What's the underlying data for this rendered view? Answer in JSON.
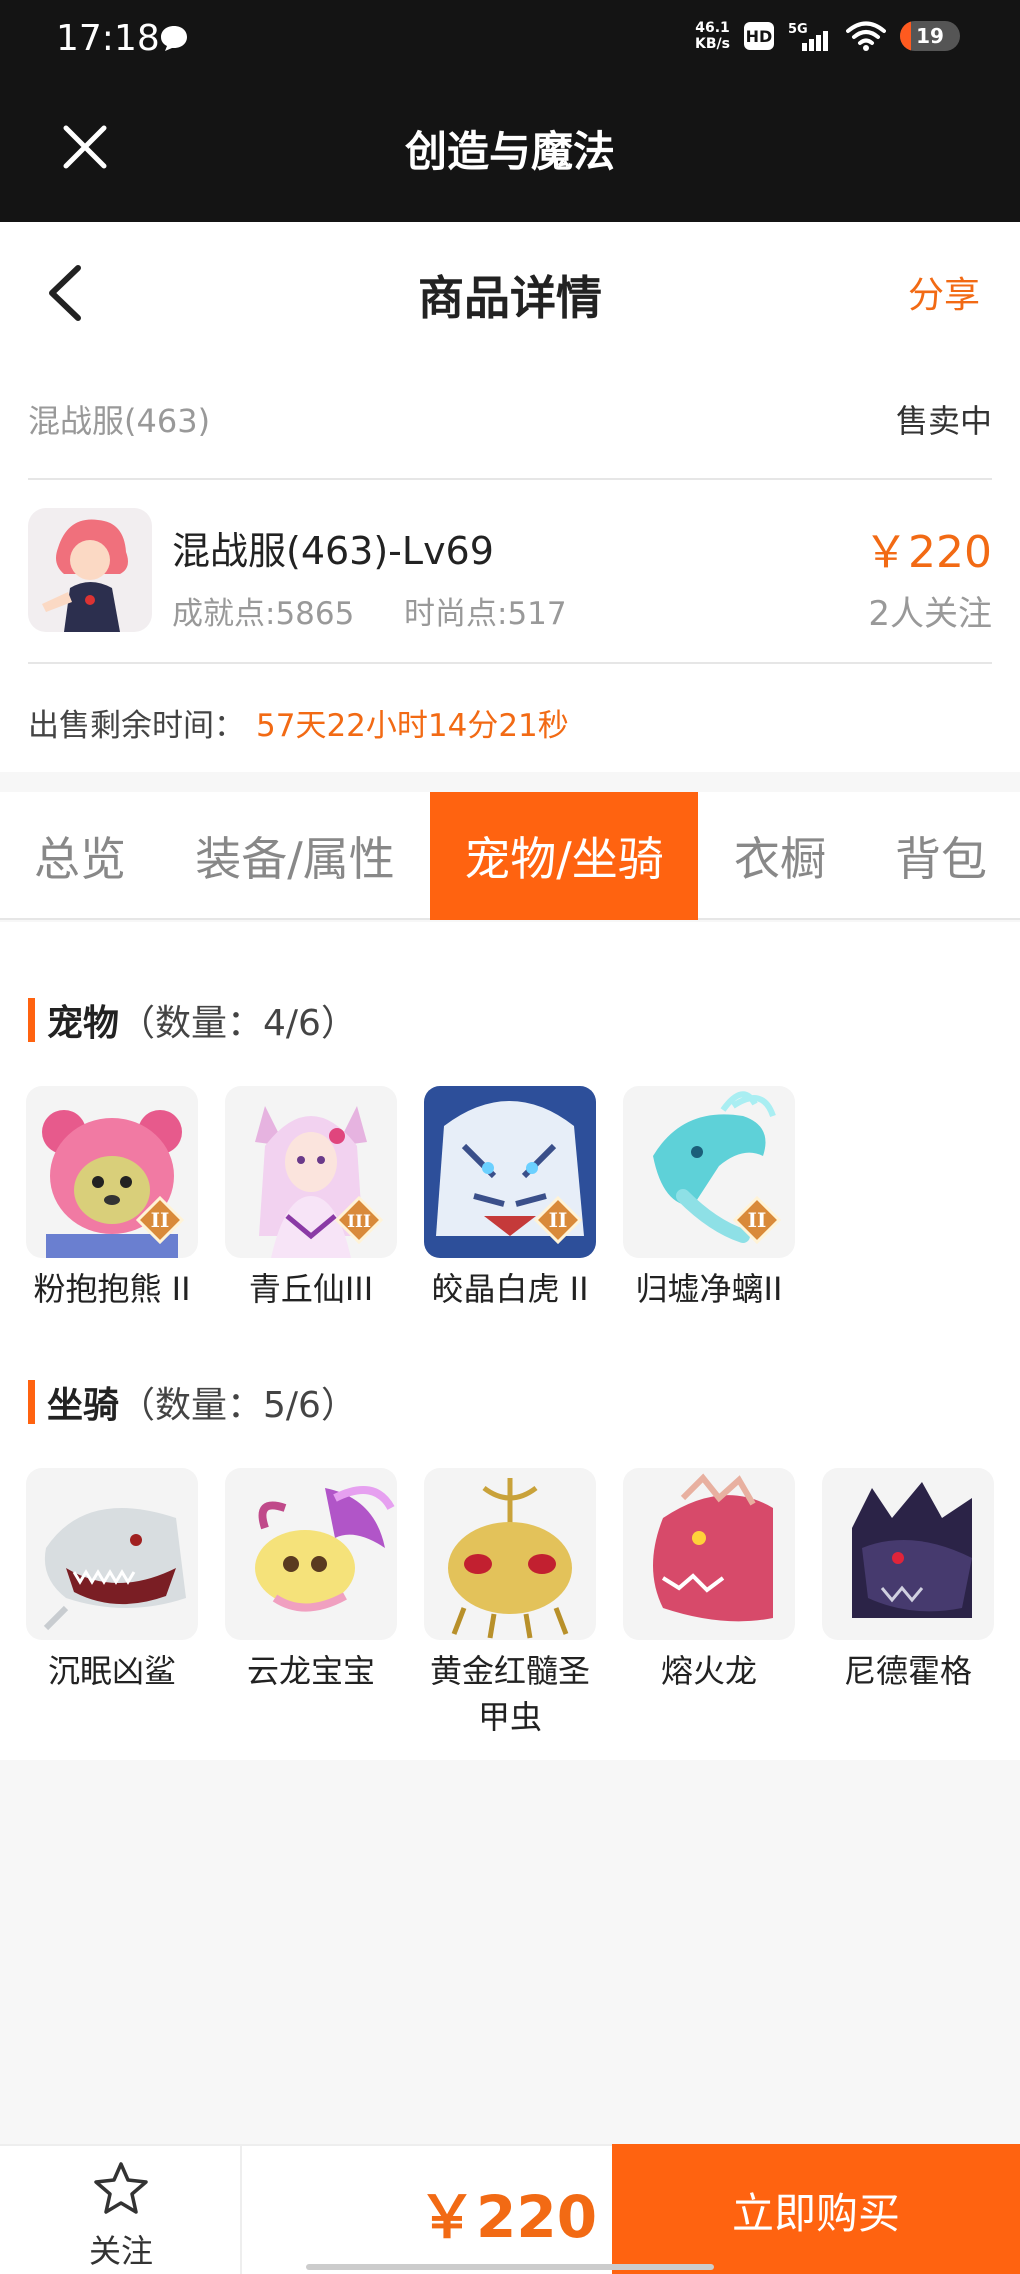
{
  "status_bar": {
    "time": "17:18",
    "net_speed_value": "46.1",
    "net_speed_unit": "KB/s",
    "hd": "HD",
    "signal": "5G",
    "battery": "19",
    "battery_level": 0.19
  },
  "app_bar": {
    "title": "创造与魔法"
  },
  "header": {
    "title": "商品详情",
    "share": "分享"
  },
  "listing": {
    "server": "混战服(463)",
    "status": "售卖中",
    "character": "混战服(463)-Lv69",
    "achievement": "成就点:5865",
    "fashion": "时尚点:517",
    "price": "￥220",
    "followers": "2人关注",
    "remaining_label": "出售剩余时间：",
    "remaining_value": "57天22小时14分21秒"
  },
  "tabs": [
    {
      "label": "总览"
    },
    {
      "label": "装备/属性"
    },
    {
      "label": "宠物/坐骑",
      "active": true
    },
    {
      "label": "衣橱"
    },
    {
      "label": "背包"
    }
  ],
  "pets": {
    "title": "宠物",
    "count": "（数量：4/6）",
    "items": [
      {
        "name": "粉抱抱熊 II",
        "rank": "II"
      },
      {
        "name": "青丘仙III",
        "rank": "III"
      },
      {
        "name": "皎晶白虎 II",
        "rank": "II"
      },
      {
        "name": "归墟净螭II",
        "rank": "II"
      }
    ]
  },
  "mounts": {
    "title": "坐骑",
    "count": "（数量：5/6）",
    "items": [
      {
        "name": "沉眠凶鲨"
      },
      {
        "name": "云龙宝宝"
      },
      {
        "name": "黄金红髓圣甲虫"
      },
      {
        "name": "熔火龙"
      },
      {
        "name": "尼德霍格"
      }
    ]
  },
  "bottom_bar": {
    "follow": "关注",
    "price": "￥220",
    "buy": "立即购买"
  },
  "colors": {
    "accent": "#ff6310",
    "price": "#f26a14",
    "dark": "#141414"
  }
}
